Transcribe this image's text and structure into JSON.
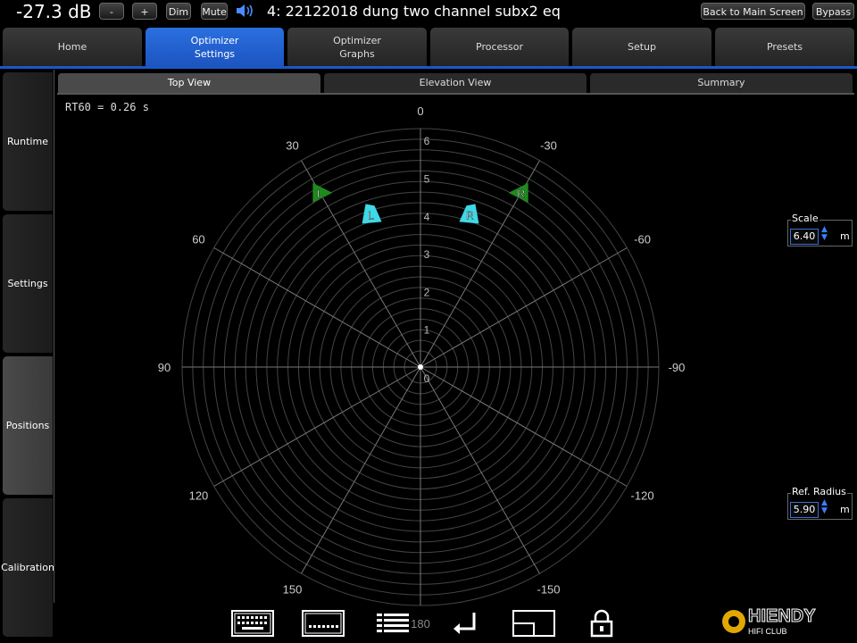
{
  "topbar": {
    "volume": "-27.3 dB",
    "minus_label": "-",
    "plus_label": "+",
    "dim_label": "Dim",
    "mute_label": "Mute",
    "preset_title": "4: 22122018 dung two channel subx2 eq",
    "back_label": "Back to Main Screen",
    "bypass_label": "Bypass"
  },
  "main_tabs": [
    {
      "label": "Home"
    },
    {
      "label": "Optimizer\nSettings",
      "active": true
    },
    {
      "label": "Optimizer\nGraphs"
    },
    {
      "label": "Processor"
    },
    {
      "label": "Setup"
    },
    {
      "label": "Presets"
    }
  ],
  "side_tabs": [
    {
      "label": "Runtime"
    },
    {
      "label": "Settings"
    },
    {
      "label": "Positions",
      "active": true
    },
    {
      "label": "Calibration"
    }
  ],
  "view_tabs": [
    {
      "label": "Top View",
      "active": true
    },
    {
      "label": "Elevation View"
    },
    {
      "label": "Summary"
    }
  ],
  "rt60": "RT60 = 0.26 s",
  "polar": {
    "angle_labels": [
      "0",
      "30",
      "-30",
      "60",
      "-60",
      "90",
      "-90",
      "120",
      "-120",
      "150",
      "-150",
      "180"
    ],
    "radial_labels": [
      "1",
      "2",
      "3",
      "4",
      "5",
      "6"
    ],
    "center_label": "0",
    "max_radius_m": 6.4,
    "speakers": [
      {
        "label": "L",
        "kind": "main",
        "color": "#1e8a1e",
        "angle_deg": 30,
        "radius_m": 5.4
      },
      {
        "label": "R",
        "kind": "main",
        "color": "#1e8a1e",
        "angle_deg": -30,
        "radius_m": 5.4
      },
      {
        "label": "L",
        "kind": "listener",
        "color": "#3ed8e6",
        "angle_deg": 18,
        "radius_m": 4.3
      },
      {
        "label": "R",
        "kind": "listener",
        "color": "#3ed8e6",
        "angle_deg": -18,
        "radius_m": 4.3
      }
    ]
  },
  "scale": {
    "label": "Scale",
    "value": "6.40",
    "unit": "m"
  },
  "ref_radius": {
    "label": "Ref. Radius",
    "value": "5.90",
    "unit": "m"
  },
  "bottom_icons": [
    "keyboard-icon",
    "keyboard-small-icon",
    "list-icon",
    "enter-icon",
    "window-icon",
    "lock-icon"
  ],
  "logo": {
    "text": "HIENDY",
    "subtitle": "HIFI CLUB"
  },
  "colors": {
    "accent": "#1c55c0",
    "grid": "#555555"
  }
}
